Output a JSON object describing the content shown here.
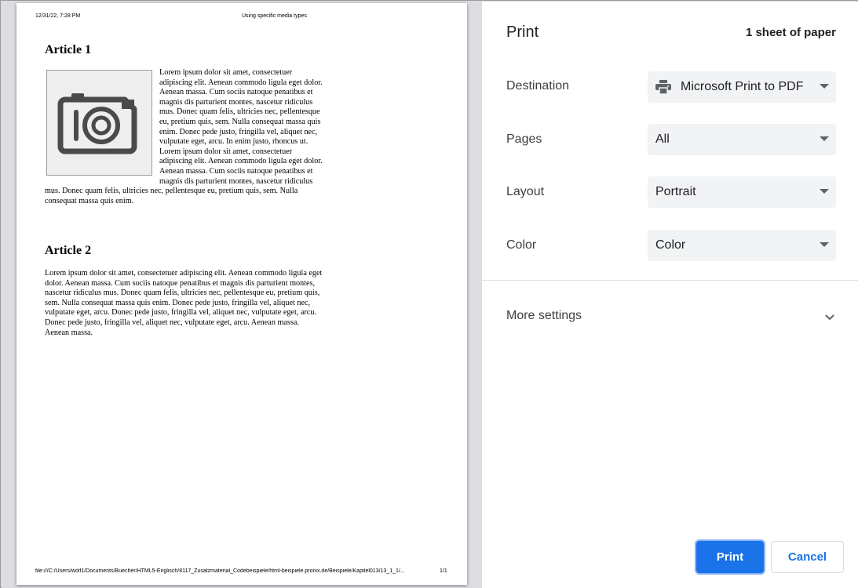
{
  "preview": {
    "header_left": "12/31/22, 7:28 PM",
    "header_right": "Using specific media types",
    "footer_left": "file:///C:/Users/wolf1/Documents/Buecher/HTML5-Englisch/8117_Zusatzmaterial_Codebeispiele/html-beispiele.pronix.de/Beispiele/Kapitel013/13_1_1/...",
    "footer_right": "1/1",
    "articles": [
      {
        "title": "Article 1",
        "image_icon": "camera-icon",
        "body": "Lorem ipsum dolor sit amet, consectetuer adipiscing elit. Aenean commodo ligula eget dolor. Aenean massa. Cum sociis natoque penatibus et magnis dis parturient montes, nascetur ridiculus mus. Donec quam felis, ultricies nec, pellentesque eu, pretium quis, sem. Nulla consequat massa quis enim. Donec pede justo, fringilla vel, aliquet nec, vulputate eget, arcu. In enim justo, rhoncus ut. Lorem ipsum dolor sit amet, consectetuer adipiscing elit. Aenean commodo ligula eget dolor. Aenean massa. Cum sociis natoque penatibus et magnis dis parturient montes, nascetur ridiculus mus. Donec quam felis, ultricies nec, pellentesque eu, pretium quis, sem. Nulla consequat massa quis enim."
      },
      {
        "title": "Article 2",
        "body": "Lorem ipsum dolor sit amet, consectetuer adipiscing elit. Aenean commodo ligula eget dolor. Aenean massa. Cum sociis natoque penatibus et magnis dis parturient montes, nascetur ridiculus mus. Donec quam felis, ultricies nec, pellentesque eu, pretium quis, sem. Nulla consequat massa quis enim. Donec pede justo, fringilla vel, aliquet nec, vulputate eget, arcu. Donec pede justo, fringilla vel, aliquet nec, vulputate eget, arcu. Donec pede justo, fringilla vel, aliquet nec, vulputate eget, arcu. Aenean massa. Aenean massa."
      }
    ]
  },
  "panel": {
    "title": "Print",
    "sheet_count": "1 sheet of paper",
    "settings": {
      "destination": {
        "label": "Destination",
        "value": "Microsoft Print to PDF",
        "icon": "printer-icon"
      },
      "pages": {
        "label": "Pages",
        "value": "All"
      },
      "layout": {
        "label": "Layout",
        "value": "Portrait"
      },
      "color": {
        "label": "Color",
        "value": "Color"
      }
    },
    "more_settings": "More settings",
    "print_button": "Print",
    "cancel_button": "Cancel"
  },
  "colors": {
    "accent": "#1a73e8",
    "select_bg": "#f1f3f4",
    "preview_bg": "#dcdde1"
  }
}
